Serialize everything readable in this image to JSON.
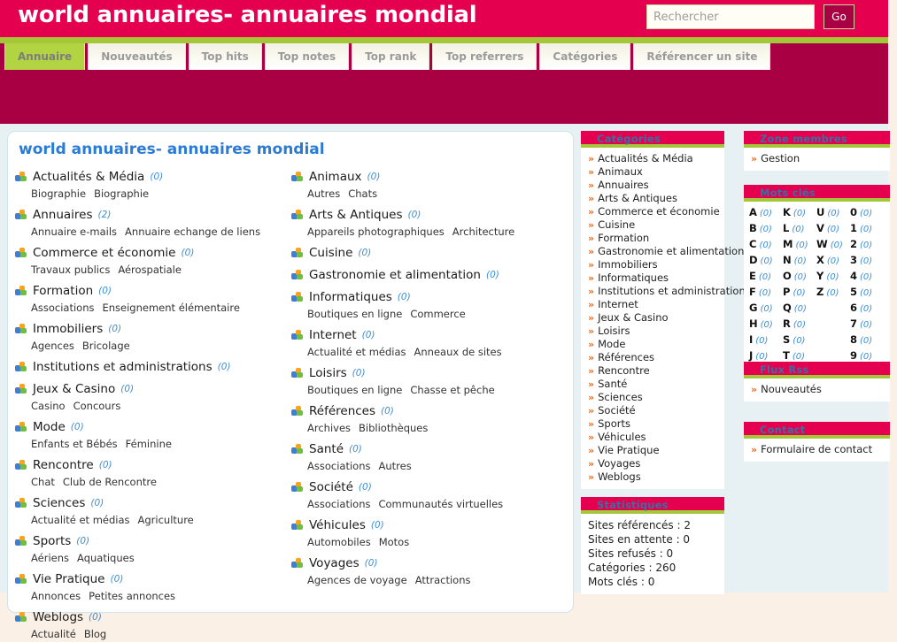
{
  "header": {
    "site_title": "world annuaires- annuaires mondial",
    "search_placeholder": "Rechercher",
    "search_value": "",
    "go_label": "Go",
    "brand_pink": "#e4004f",
    "brand_dark": "#a80042",
    "brand_green": "#a4c639"
  },
  "nav": {
    "tabs": [
      {
        "label": "Annuaire",
        "active": true
      },
      {
        "label": "Nouveautés",
        "active": false
      },
      {
        "label": "Top hits",
        "active": false
      },
      {
        "label": "Top notes",
        "active": false
      },
      {
        "label": "Top rank",
        "active": false
      },
      {
        "label": "Top referrers",
        "active": false
      },
      {
        "label": "Catégories",
        "active": false
      },
      {
        "label": "Référencer un site",
        "active": false
      }
    ]
  },
  "main": {
    "title": "world annuaires- annuaires mondial",
    "left_column": [
      {
        "name": "Actualités & Média",
        "count": "(0)",
        "subs": [
          "Biographie",
          "Biographie"
        ]
      },
      {
        "name": "Annuaires",
        "count": "(2)",
        "subs": [
          "Annuaire e-mails",
          "Annuaire echange de liens"
        ]
      },
      {
        "name": "Commerce et économie",
        "count": "(0)",
        "subs": [
          "Travaux publics",
          "Aérospatiale"
        ]
      },
      {
        "name": "Formation",
        "count": "(0)",
        "subs": [
          "Associations",
          "Enseignement élémentaire"
        ]
      },
      {
        "name": "Immobiliers",
        "count": "(0)",
        "subs": [
          "Agences",
          "Bricolage"
        ]
      },
      {
        "name": "Institutions et administrations",
        "count": "(0)",
        "subs": []
      },
      {
        "name": "Jeux & Casino",
        "count": "(0)",
        "subs": [
          "Casino",
          "Concours"
        ]
      },
      {
        "name": "Mode",
        "count": "(0)",
        "subs": [
          "Enfants et Bébés",
          "Féminine"
        ]
      },
      {
        "name": "Rencontre",
        "count": "(0)",
        "subs": [
          "Chat",
          "Club de Rencontre"
        ]
      },
      {
        "name": "Sciences",
        "count": "(0)",
        "subs": [
          "Actualité et médias",
          "Agriculture"
        ]
      },
      {
        "name": "Sports",
        "count": "(0)",
        "subs": [
          "Aériens",
          "Aquatiques"
        ]
      },
      {
        "name": "Vie Pratique",
        "count": "(0)",
        "subs": [
          "Annonces",
          "Petites annonces"
        ]
      },
      {
        "name": "Weblogs",
        "count": "(0)",
        "subs": [
          "Actualité",
          "Blog"
        ]
      }
    ],
    "right_column": [
      {
        "name": "Animaux",
        "count": "(0)",
        "subs": [
          "Autres",
          "Chats"
        ]
      },
      {
        "name": "Arts & Antiques",
        "count": "(0)",
        "subs": [
          "Appareils photographiques",
          "Architecture"
        ]
      },
      {
        "name": "Cuisine",
        "count": "(0)",
        "subs": []
      },
      {
        "name": "Gastronomie et alimentation",
        "count": "(0)",
        "subs": []
      },
      {
        "name": "Informatiques",
        "count": "(0)",
        "subs": [
          "Boutiques en ligne",
          "Commerce"
        ]
      },
      {
        "name": "Internet",
        "count": "(0)",
        "subs": [
          "Actualité et médias",
          "Anneaux de sites"
        ]
      },
      {
        "name": "Loisirs",
        "count": "(0)",
        "subs": [
          "Boutiques en ligne",
          "Chasse et pêche"
        ]
      },
      {
        "name": "Références",
        "count": "(0)",
        "subs": [
          "Archives",
          "Bibliothèques"
        ]
      },
      {
        "name": "Santé",
        "count": "(0)",
        "subs": [
          "Associations",
          "Autres"
        ]
      },
      {
        "name": "Société",
        "count": "(0)",
        "subs": [
          "Associations",
          "Communautés virtuelles"
        ]
      },
      {
        "name": "Véhicules",
        "count": "(0)",
        "subs": [
          "Automobiles",
          "Motos"
        ]
      },
      {
        "name": "Voyages",
        "count": "(0)",
        "subs": [
          "Agences de voyage",
          "Attractions"
        ]
      }
    ]
  },
  "sidebar": {
    "categories": {
      "title": "Catégories",
      "items": [
        "Actualités & Média",
        "Animaux",
        "Annuaires",
        "Arts & Antiques",
        "Commerce et économie",
        "Cuisine",
        "Formation",
        "Gastronomie et alimentation",
        "Immobiliers",
        "Informatiques",
        "Institutions et administrations",
        "Internet",
        "Jeux & Casino",
        "Loisirs",
        "Mode",
        "Références",
        "Rencontre",
        "Santé",
        "Sciences",
        "Société",
        "Sports",
        "Véhicules",
        "Vie Pratique",
        "Voyages",
        "Weblogs"
      ]
    },
    "statistics": {
      "title": "Statistiques",
      "lines": [
        "Sites référencés : 2",
        "Sites en attente : 0",
        "Sites refusés : 0",
        "Catégories : 260",
        "Mots clés : 0"
      ]
    },
    "members": {
      "title": "Zone membres",
      "items": [
        "Gestion"
      ]
    },
    "keywords": {
      "title": "Mots clés",
      "columns": [
        [
          [
            "A",
            "(0)"
          ],
          [
            "B",
            "(0)"
          ],
          [
            "C",
            "(0)"
          ],
          [
            "D",
            "(0)"
          ],
          [
            "E",
            "(0)"
          ],
          [
            "F",
            "(0)"
          ],
          [
            "G",
            "(0)"
          ],
          [
            "H",
            "(0)"
          ],
          [
            "I",
            "(0)"
          ],
          [
            "J",
            "(0)"
          ]
        ],
        [
          [
            "K",
            "(0)"
          ],
          [
            "L",
            "(0)"
          ],
          [
            "M",
            "(0)"
          ],
          [
            "N",
            "(0)"
          ],
          [
            "O",
            "(0)"
          ],
          [
            "P",
            "(0)"
          ],
          [
            "Q",
            "(0)"
          ],
          [
            "R",
            "(0)"
          ],
          [
            "S",
            "(0)"
          ],
          [
            "T",
            "(0)"
          ]
        ],
        [
          [
            "U",
            "(0)"
          ],
          [
            "V",
            "(0)"
          ],
          [
            "W",
            "(0)"
          ],
          [
            "X",
            "(0)"
          ],
          [
            "Y",
            "(0)"
          ],
          [
            "Z",
            "(0)"
          ]
        ],
        [
          [
            "0",
            "(0)"
          ],
          [
            "1",
            "(0)"
          ],
          [
            "2",
            "(0)"
          ],
          [
            "3",
            "(0)"
          ],
          [
            "4",
            "(0)"
          ],
          [
            "5",
            "(0)"
          ],
          [
            "6",
            "(0)"
          ],
          [
            "7",
            "(0)"
          ],
          [
            "8",
            "(0)"
          ],
          [
            "9",
            "(0)"
          ]
        ]
      ]
    },
    "rss": {
      "title": "Flux Rss",
      "items": [
        "Nouveautés"
      ]
    },
    "contact": {
      "title": "Contact",
      "items": [
        "Formulaire de contact"
      ]
    }
  }
}
